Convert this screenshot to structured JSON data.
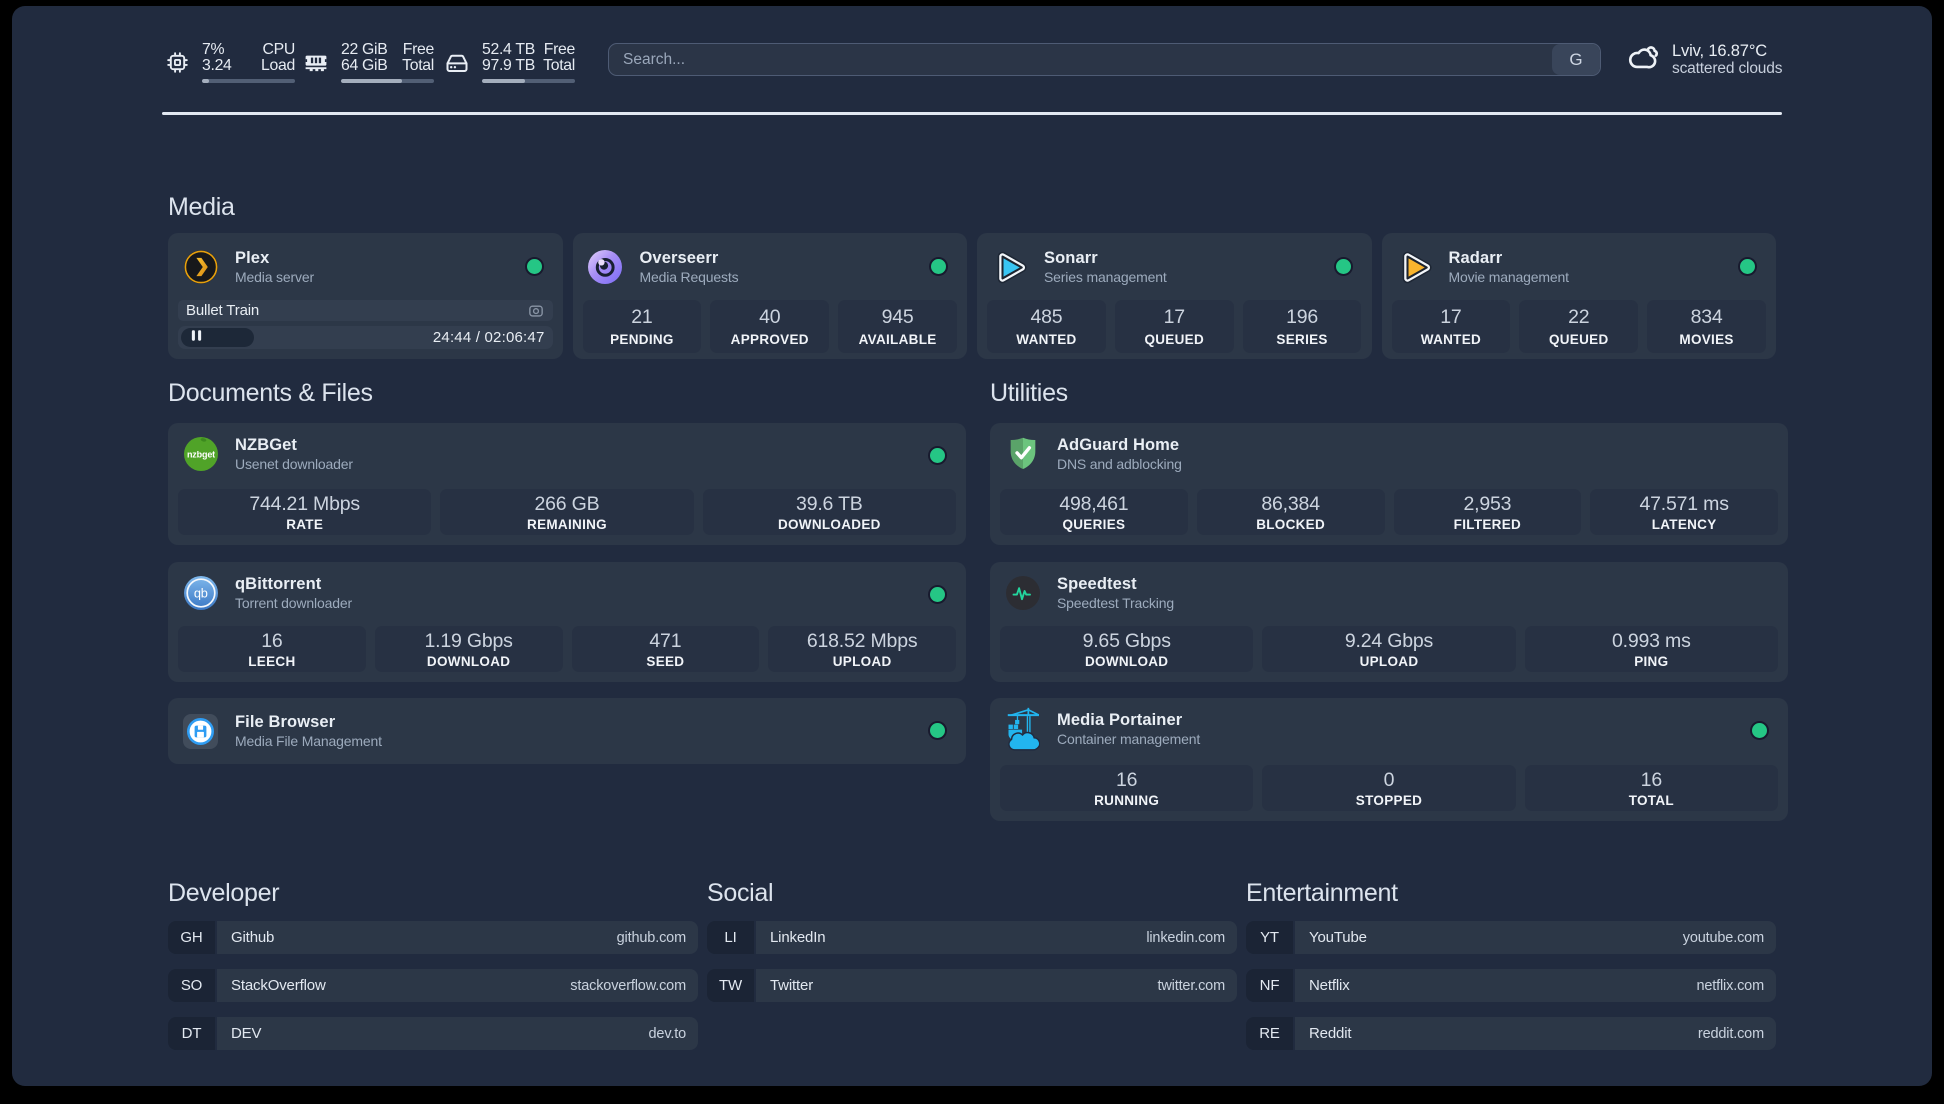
{
  "colors": {
    "page_background": "#212b3f",
    "card_background": "#2c3747",
    "tile_background": "#273143",
    "row_background": "#333e4f",
    "pill_background": "#1d2838",
    "abbr_background": "#1b2435",
    "status_online": "#25c685",
    "divider": "#e2e8f1",
    "title_text": "#e9eef4",
    "subtitle_text": "#9dabbd"
  },
  "header": {
    "resources": [
      {
        "icon": "cpu-icon",
        "left_top": "7%",
        "left_bottom": "3.24",
        "right_top": "CPU",
        "right_bottom": "Load",
        "progress_percent": 7
      },
      {
        "icon": "memory-icon",
        "left_top": "22 GiB",
        "left_bottom": "64 GiB",
        "right_top": "Free",
        "right_bottom": "Total",
        "progress_percent": 65.6
      },
      {
        "icon": "disk-icon",
        "left_top": "52.4 TB",
        "left_bottom": "97.9 TB",
        "right_top": "Free",
        "right_bottom": "Total",
        "progress_percent": 46.5
      }
    ],
    "search": {
      "placeholder": "Search...",
      "provider": "G"
    },
    "weather": {
      "icon": "scattered-clouds-icon",
      "location_temperature": "Lviv, 16.87°C",
      "condition": "scattered clouds"
    }
  },
  "sections": {
    "media": {
      "title": "Media",
      "services": [
        {
          "name": "Plex",
          "description": "Media server",
          "icon": "plex-icon",
          "status": "online",
          "now_playing": {
            "title": "Bullet Train",
            "time": "24:44 / 02:06:47",
            "progress_percent": 19.5
          }
        },
        {
          "name": "Overseerr",
          "description": "Media Requests",
          "icon": "overseerr-icon",
          "status": "online",
          "stats": [
            {
              "value": "21",
              "label": "PENDING"
            },
            {
              "value": "40",
              "label": "APPROVED"
            },
            {
              "value": "945",
              "label": "AVAILABLE"
            }
          ]
        },
        {
          "name": "Sonarr",
          "description": "Series management",
          "icon": "sonarr-icon",
          "status": "online",
          "stats": [
            {
              "value": "485",
              "label": "WANTED"
            },
            {
              "value": "17",
              "label": "QUEUED"
            },
            {
              "value": "196",
              "label": "SERIES"
            }
          ]
        },
        {
          "name": "Radarr",
          "description": "Movie management",
          "icon": "radarr-icon",
          "status": "online",
          "stats": [
            {
              "value": "17",
              "label": "WANTED"
            },
            {
              "value": "22",
              "label": "QUEUED"
            },
            {
              "value": "834",
              "label": "MOVIES"
            }
          ]
        }
      ]
    },
    "documents": {
      "title": "Documents & Files",
      "services": [
        {
          "name": "NZBGet",
          "description": "Usenet downloader",
          "icon": "nzbget-icon",
          "status": "online",
          "stats": [
            {
              "value": "744.21 Mbps",
              "label": "RATE"
            },
            {
              "value": "266 GB",
              "label": "REMAINING"
            },
            {
              "value": "39.6 TB",
              "label": "DOWNLOADED"
            }
          ]
        },
        {
          "name": "qBittorrent",
          "description": "Torrent downloader",
          "icon": "qbittorrent-icon",
          "status": "online",
          "stats": [
            {
              "value": "16",
              "label": "LEECH"
            },
            {
              "value": "1.19 Gbps",
              "label": "DOWNLOAD"
            },
            {
              "value": "471",
              "label": "SEED"
            },
            {
              "value": "618.52 Mbps",
              "label": "UPLOAD"
            }
          ]
        },
        {
          "name": "File Browser",
          "description": "Media File Management",
          "icon": "filebrowser-icon",
          "status": "online",
          "stats": []
        }
      ]
    },
    "utilities": {
      "title": "Utilities",
      "services": [
        {
          "name": "AdGuard Home",
          "description": "DNS and adblocking",
          "icon": "adguard-icon",
          "status": null,
          "stats": [
            {
              "value": "498,461",
              "label": "QUERIES"
            },
            {
              "value": "86,384",
              "label": "BLOCKED"
            },
            {
              "value": "2,953",
              "label": "FILTERED"
            },
            {
              "value": "47.571 ms",
              "label": "LATENCY"
            }
          ]
        },
        {
          "name": "Speedtest",
          "description": "Speedtest Tracking",
          "icon": "speedtest-icon",
          "status": null,
          "stats": [
            {
              "value": "9.65 Gbps",
              "label": "DOWNLOAD"
            },
            {
              "value": "9.24 Gbps",
              "label": "UPLOAD"
            },
            {
              "value": "0.993 ms",
              "label": "PING"
            }
          ]
        },
        {
          "name": "Media Portainer",
          "description": "Container management",
          "icon": "portainer-icon",
          "status": "online",
          "stats": [
            {
              "value": "16",
              "label": "RUNNING"
            },
            {
              "value": "0",
              "label": "STOPPED"
            },
            {
              "value": "16",
              "label": "TOTAL"
            }
          ]
        }
      ]
    },
    "bookmarks": {
      "groups": [
        {
          "title": "Developer",
          "items": [
            {
              "abbr": "GH",
              "name": "Github",
              "url": "github.com"
            },
            {
              "abbr": "SO",
              "name": "StackOverflow",
              "url": "stackoverflow.com"
            },
            {
              "abbr": "DT",
              "name": "DEV",
              "url": "dev.to"
            }
          ]
        },
        {
          "title": "Social",
          "items": [
            {
              "abbr": "LI",
              "name": "LinkedIn",
              "url": "linkedin.com"
            },
            {
              "abbr": "TW",
              "name": "Twitter",
              "url": "twitter.com"
            }
          ]
        },
        {
          "title": "Entertainment",
          "items": [
            {
              "abbr": "YT",
              "name": "YouTube",
              "url": "youtube.com"
            },
            {
              "abbr": "NF",
              "name": "Netflix",
              "url": "netflix.com"
            },
            {
              "abbr": "RE",
              "name": "Reddit",
              "url": "reddit.com"
            }
          ]
        }
      ]
    }
  }
}
